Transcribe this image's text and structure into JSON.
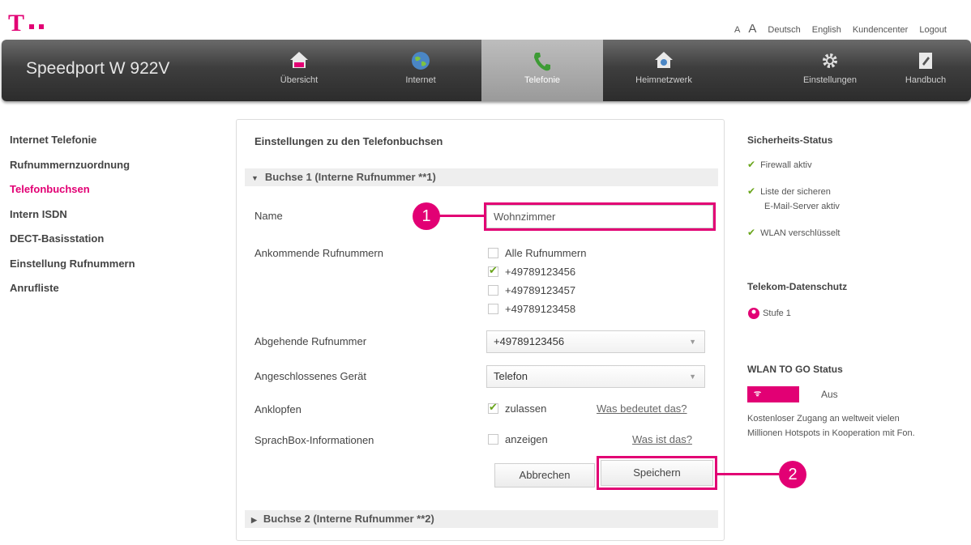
{
  "top_links": {
    "font_small": "A",
    "font_large": "A",
    "lang_de": "Deutsch",
    "lang_en": "English",
    "kundencenter": "Kundencenter",
    "logout": "Logout"
  },
  "brand": "Speedport W 922V",
  "nav": [
    {
      "label": "Übersicht",
      "icon": "home-icon"
    },
    {
      "label": "Internet",
      "icon": "globe-icon"
    },
    {
      "label": "Telefonie",
      "icon": "phone-icon",
      "active": true
    },
    {
      "label": "Heimnetzwerk",
      "icon": "home-network-icon"
    },
    {
      "label": "Einstellungen",
      "icon": "gear-icon"
    },
    {
      "label": "Handbuch",
      "icon": "book-icon"
    }
  ],
  "sidebar": [
    {
      "label": "Internet Telefonie"
    },
    {
      "label": "Rufnummernzuordnung"
    },
    {
      "label": "Telefonbuchsen",
      "active": true
    },
    {
      "label": "Intern ISDN"
    },
    {
      "label": "DECT-Basisstation"
    },
    {
      "label": "Einstellung Rufnummern"
    },
    {
      "label": "Anrufliste"
    }
  ],
  "panel": {
    "title": "Einstellungen zu den Telefonbuchsen",
    "section1": "Buchse 1 (Interne Rufnummer **1)",
    "section2": "Buchse 2 (Interne Rufnummer **2)",
    "name_label": "Name",
    "name_value": "Wohnzimmer",
    "incoming_label": "Ankommende Rufnummern",
    "incoming_options": [
      {
        "label": "Alle Rufnummern",
        "checked": false
      },
      {
        "label": "+49789123456",
        "checked": true
      },
      {
        "label": "+49789123457",
        "checked": false
      },
      {
        "label": "+49789123458",
        "checked": false
      }
    ],
    "outgoing_label": "Abgehende Rufnummer",
    "outgoing_value": "+49789123456",
    "device_label": "Angeschlossenes Gerät",
    "device_value": "Telefon",
    "knock_label": "Anklopfen",
    "knock_option": "zulassen",
    "knock_help": "Was bedeutet das?",
    "mailbox_label": "SprachBox-Informationen",
    "mailbox_option": "anzeigen",
    "mailbox_help": "Was ist das?",
    "cancel_button": "Abbrechen",
    "save_button": "Speichern"
  },
  "callouts": {
    "one": "1",
    "two": "2"
  },
  "right": {
    "security_title": "Sicherheits-Status",
    "firewall": "Firewall aktiv",
    "mail_list_1": "Liste der sicheren",
    "mail_list_2": "E-Mail-Server aktiv",
    "wlan": "WLAN verschlüsselt",
    "privacy_title": "Telekom-Datenschutz",
    "privacy_level": "Stufe 1",
    "wlan_togo_title": "WLAN TO GO Status",
    "hotspot_badge": "HOTSPOT",
    "hotspot_status": "Aus",
    "hotspot_desc_1": "Kostenloser Zugang an weltweit vielen",
    "hotspot_desc_2": "Millionen Hotspots in Kooperation mit Fon."
  },
  "colors": {
    "accent": "#e20074",
    "check": "#6aa51c",
    "nav_dark": "#3e3e3e"
  }
}
